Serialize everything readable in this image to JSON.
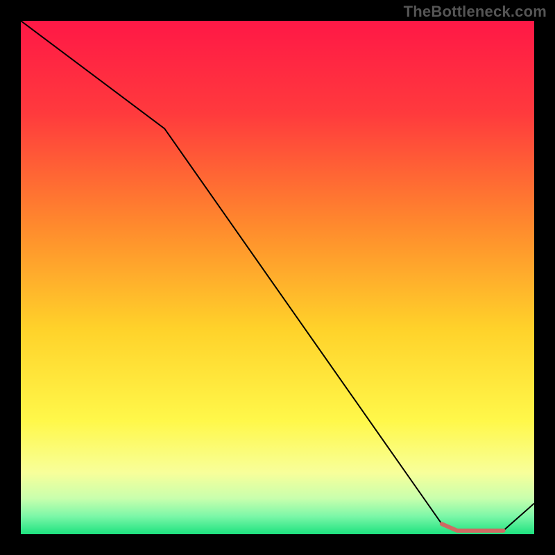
{
  "watermark": "TheBottleneck.com",
  "chart_data": {
    "type": "line",
    "title": "",
    "xlabel": "",
    "ylabel": "",
    "xlim": [
      0,
      100
    ],
    "ylim": [
      0,
      100
    ],
    "series": [
      {
        "name": "line",
        "color": "#000000",
        "stroke_width": 2,
        "points": [
          {
            "x": 0,
            "y": 100
          },
          {
            "x": 28,
            "y": 79
          },
          {
            "x": 82,
            "y": 2
          },
          {
            "x": 85,
            "y": 0.7
          },
          {
            "x": 94,
            "y": 0.7
          },
          {
            "x": 100,
            "y": 6
          }
        ]
      },
      {
        "name": "marker-band",
        "color": "#cf6a63",
        "stroke_width": 6,
        "points": [
          {
            "x": 82,
            "y": 2
          },
          {
            "x": 85,
            "y": 0.7
          },
          {
            "x": 94,
            "y": 0.7
          }
        ]
      }
    ],
    "gradient_stops": [
      {
        "offset": 0,
        "color": "#ff1846"
      },
      {
        "offset": 0.18,
        "color": "#ff3a3d"
      },
      {
        "offset": 0.4,
        "color": "#ff8a2d"
      },
      {
        "offset": 0.6,
        "color": "#ffd22a"
      },
      {
        "offset": 0.78,
        "color": "#fff84a"
      },
      {
        "offset": 0.88,
        "color": "#f8ff9a"
      },
      {
        "offset": 0.93,
        "color": "#c9ffad"
      },
      {
        "offset": 0.965,
        "color": "#7cf7a8"
      },
      {
        "offset": 1.0,
        "color": "#1de27f"
      }
    ]
  }
}
